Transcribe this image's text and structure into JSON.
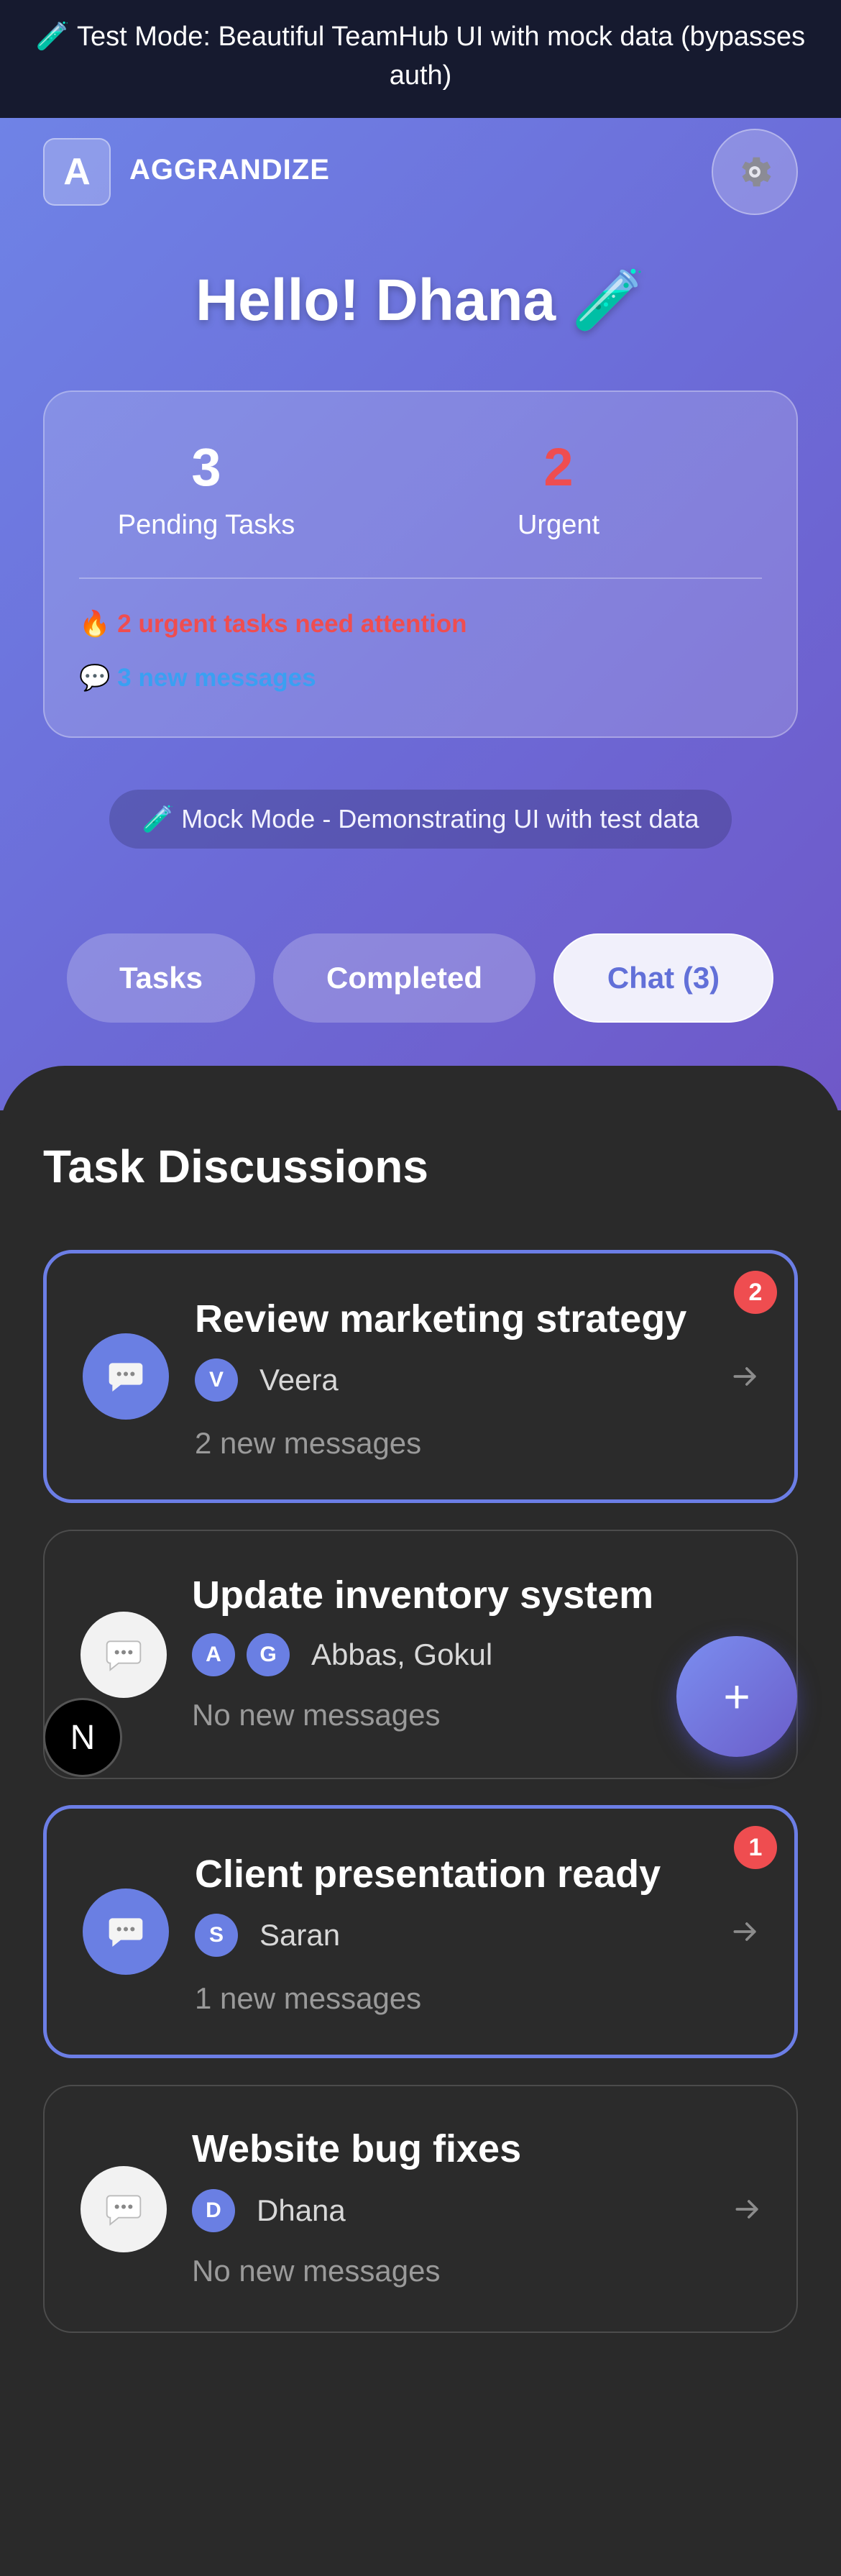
{
  "banner": {
    "text": "🧪 Test Mode: Beautiful TeamHub UI with mock data (bypasses auth)"
  },
  "header": {
    "logo_letter": "A",
    "brand": "AGGRANDIZE",
    "settings_icon": "gear-icon"
  },
  "greeting": "Hello! Dhana 🧪",
  "stats": {
    "pending_count": "3",
    "pending_label": "Pending Tasks",
    "urgent_count": "2",
    "urgent_label": "Urgent",
    "urgent_alert": "🔥 2 urgent tasks need attention",
    "messages_alert": "💬 3 new messages",
    "colors": {
      "urgent": "#ef4d50",
      "messages": "#3aa0f2"
    }
  },
  "mock_notice": "🧪 Mock Mode - Demonstrating UI with test data",
  "tabs": [
    {
      "label": "Tasks",
      "active": false
    },
    {
      "label": "Completed",
      "active": false
    },
    {
      "label": "Chat (3)",
      "active": true
    }
  ],
  "section_title": "Task Discussions",
  "discussions": [
    {
      "title": "Review marketing strategy",
      "avatars": [
        "V"
      ],
      "names": "Veera",
      "status": "2 new messages",
      "badge": "2",
      "unread": true
    },
    {
      "title": "Update inventory system",
      "avatars": [
        "A",
        "G"
      ],
      "names": "Abbas, Gokul",
      "status": "No new messages",
      "badge": "",
      "unread": false
    },
    {
      "title": "Client presentation ready",
      "avatars": [
        "S"
      ],
      "names": "Saran",
      "status": "1 new messages",
      "badge": "1",
      "unread": true
    },
    {
      "title": "Website bug fixes",
      "avatars": [
        "D"
      ],
      "names": "Dhana",
      "status": "No new messages",
      "badge": "",
      "unread": false
    }
  ],
  "fab": {
    "label": "+"
  },
  "dev_badge": {
    "label": "N"
  }
}
